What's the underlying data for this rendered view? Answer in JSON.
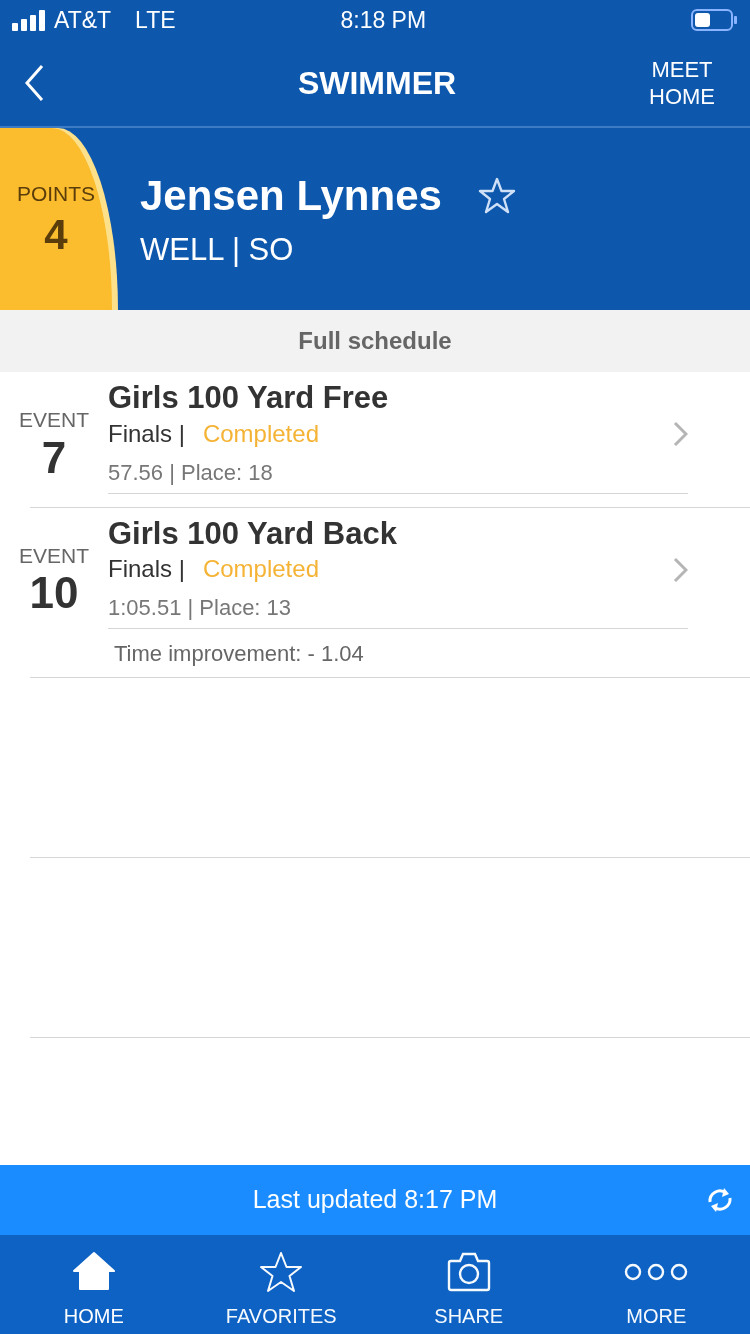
{
  "status_bar": {
    "carrier": "AT&T",
    "network": "LTE",
    "time": "8:18 PM"
  },
  "nav": {
    "title": "SWIMMER",
    "right_button": "MEET HOME"
  },
  "swimmer": {
    "points_label": "POINTS",
    "points": "4",
    "name": "Jensen Lynnes",
    "favorite": false,
    "team_year": "WELL | SO"
  },
  "section_header": "Full schedule",
  "events": [
    {
      "label": "EVENT",
      "number": "7",
      "title": "Girls 100 Yard Free",
      "round": "Finals |",
      "status": "Completed",
      "result": "57.56 | Place: 18"
    },
    {
      "label": "EVENT",
      "number": "10",
      "title": "Girls 100 Yard Back",
      "round": "Finals |",
      "status": "Completed",
      "result": "1:05.51 | Place: 13",
      "improvement": "Time improvement: - 1.04"
    }
  ],
  "update_bar": {
    "text": "Last updated 8:17 PM"
  },
  "tabs": [
    {
      "label": "HOME",
      "kind": "home",
      "selected": true
    },
    {
      "label": "FAVORITES",
      "kind": "star",
      "selected": false
    },
    {
      "label": "SHARE",
      "kind": "camera",
      "selected": false
    },
    {
      "label": "MORE",
      "kind": "more",
      "selected": false
    }
  ]
}
